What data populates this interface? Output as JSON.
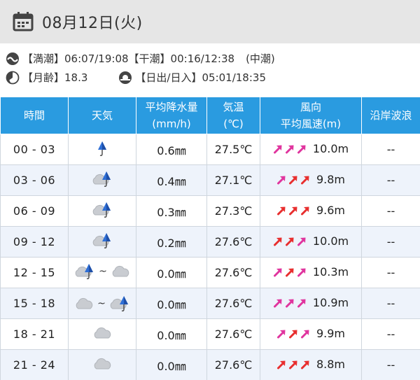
{
  "header": {
    "date": "08月12日(火)"
  },
  "tide": {
    "high_label": "【満潮】",
    "high_value": "06:07/19:08",
    "low_label": "【干潮】",
    "low_value": "00:16/12:38",
    "tide_type": "(中潮)"
  },
  "moon": {
    "label": "【月齢】",
    "value": "18.3"
  },
  "sun": {
    "label": "【日出/日入】",
    "value": "05:01/18:35"
  },
  "table": {
    "headers": {
      "time": "時間",
      "weather": "天気",
      "rain_1": "平均降水量",
      "rain_2": "(mm/h)",
      "temp_1": "気温",
      "temp_2": "(℃)",
      "wind_1": "風向",
      "wind_2": "平均風速(m)",
      "wave": "沿岸波浪"
    },
    "rows": [
      {
        "time": "00 - 03",
        "weather": [
          "rain"
        ],
        "rain": "0.6㎜",
        "temp": "27.5℃",
        "arrows": [
          "#e0359e",
          "#e0359e",
          "#e0359e"
        ],
        "wind": "10.0m",
        "wave": "--"
      },
      {
        "time": "03 - 06",
        "weather": [
          "cloud-rain"
        ],
        "rain": "0.4㎜",
        "temp": "27.1℃",
        "arrows": [
          "#e0359e",
          "#e82f2f",
          "#e82f2f"
        ],
        "wind": "9.8m",
        "wave": "--"
      },
      {
        "time": "06 - 09",
        "weather": [
          "cloud-rain"
        ],
        "rain": "0.3㎜",
        "temp": "27.3℃",
        "arrows": [
          "#e82f2f",
          "#e82f2f",
          "#e82f2f"
        ],
        "wind": "9.6m",
        "wave": "--"
      },
      {
        "time": "09 - 12",
        "weather": [
          "cloud-rain"
        ],
        "rain": "0.2㎜",
        "temp": "27.6℃",
        "arrows": [
          "#e82f2f",
          "#e82f2f",
          "#e0359e"
        ],
        "wind": "10.0m",
        "wave": "--"
      },
      {
        "time": "12 - 15",
        "weather": [
          "cloud-rain",
          "cloud"
        ],
        "tilde": "~",
        "rain": "0.0㎜",
        "temp": "27.6℃",
        "arrows": [
          "#e0359e",
          "#e82f2f",
          "#e0359e"
        ],
        "wind": "10.3m",
        "wave": "--"
      },
      {
        "time": "15 - 18",
        "weather": [
          "cloud",
          "cloud-rain"
        ],
        "tilde": "~",
        "rain": "0.0㎜",
        "temp": "27.6℃",
        "arrows": [
          "#e0359e",
          "#e0359e",
          "#e0359e"
        ],
        "wind": "10.9m",
        "wave": "--"
      },
      {
        "time": "18 - 21",
        "weather": [
          "cloud"
        ],
        "rain": "0.0㎜",
        "temp": "27.6℃",
        "arrows": [
          "#e0359e",
          "#e82f2f",
          "#e0359e"
        ],
        "wind": "9.9m",
        "wave": "--"
      },
      {
        "time": "21 - 24",
        "weather": [
          "cloud"
        ],
        "rain": "0.0㎜",
        "temp": "27.6℃",
        "arrows": [
          "#e82f2f",
          "#e82f2f",
          "#e82f2f"
        ],
        "wind": "8.8m",
        "wave": "--"
      }
    ]
  },
  "colors": {
    "header_bg": "#2a9be0",
    "date_bar_bg": "#e6e6e6",
    "alt_row_bg": "#eef3fb",
    "arrow_magenta": "#e0359e",
    "arrow_red": "#e82f2f"
  }
}
